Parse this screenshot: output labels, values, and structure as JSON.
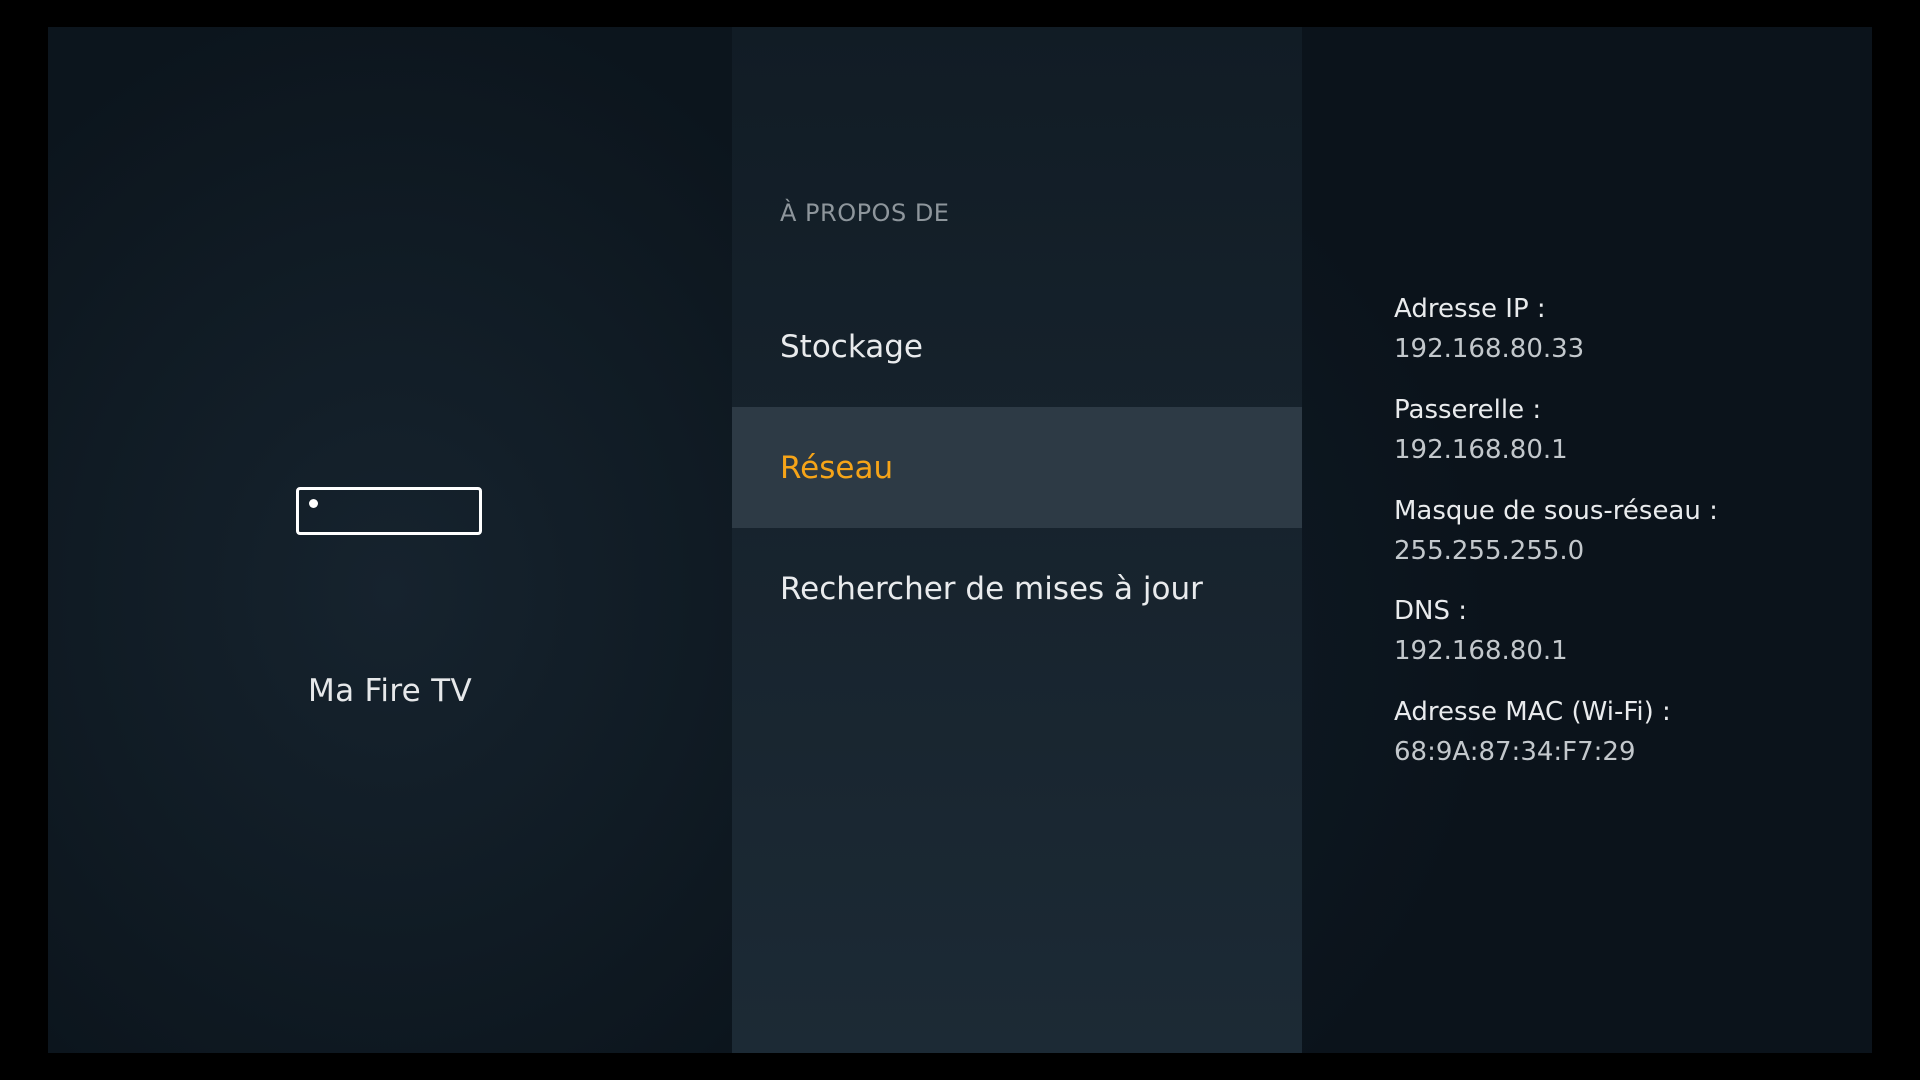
{
  "device": {
    "name": "Ma Fire TV",
    "icon": "fire-tv-device-icon"
  },
  "menu": {
    "section_title": "À PROPOS DE",
    "items": [
      {
        "label": "Stockage",
        "selected": false
      },
      {
        "label": "Réseau",
        "selected": true
      },
      {
        "label": "Rechercher de mises à jour",
        "selected": false
      }
    ]
  },
  "network_info": [
    {
      "label": "Adresse IP :",
      "value": "192.168.80.33"
    },
    {
      "label": "Passerelle :",
      "value": "192.168.80.1"
    },
    {
      "label": "Masque de sous-réseau :",
      "value": "255.255.255.0"
    },
    {
      "label": "DNS :",
      "value": "192.168.80.1"
    },
    {
      "label": "Adresse MAC (Wi-Fi) :",
      "value": "68:9A:87:34:F7:29"
    }
  ],
  "colors": {
    "accent": "#f6a418",
    "selected_bg": "#2d3a45"
  }
}
